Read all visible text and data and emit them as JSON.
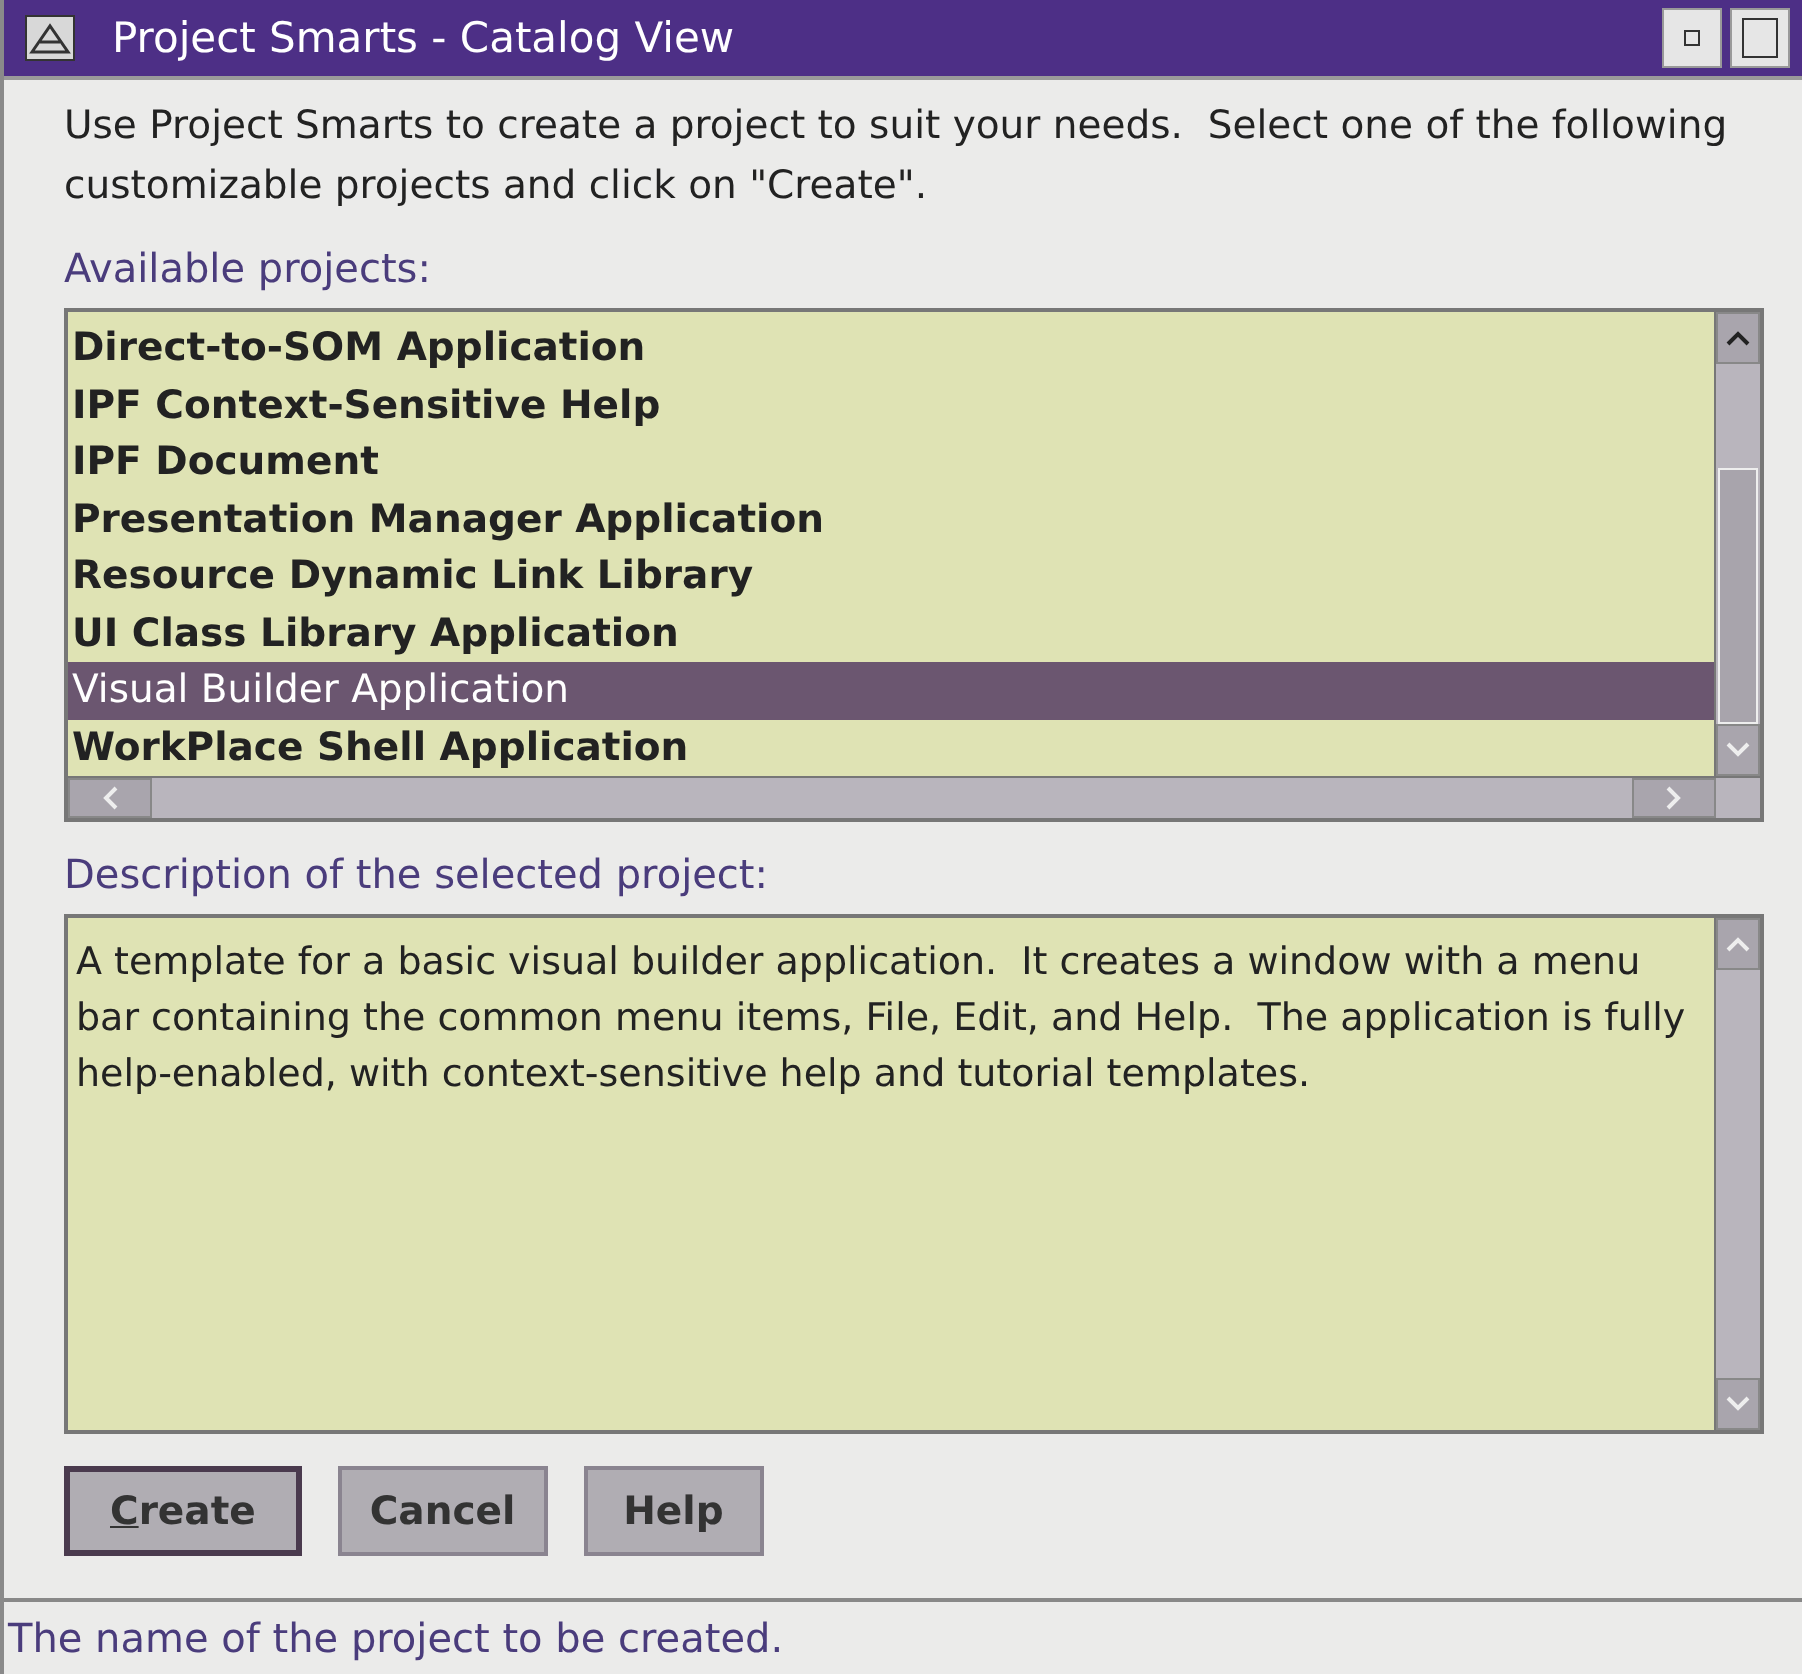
{
  "window": {
    "title": "Project Smarts - Catalog View"
  },
  "intro": "Use Project Smarts to create a project to suit your needs.  Select one of the following customizable projects and click on \"Create\".",
  "projects": {
    "label": "Available projects:",
    "items": [
      {
        "label": "Direct-to-SOM Application",
        "selected": false
      },
      {
        "label": "IPF Context-Sensitive Help",
        "selected": false
      },
      {
        "label": "IPF Document",
        "selected": false
      },
      {
        "label": "Presentation Manager Application",
        "selected": false
      },
      {
        "label": "Resource Dynamic Link Library",
        "selected": false
      },
      {
        "label": "UI Class Library Application",
        "selected": false
      },
      {
        "label": "Visual Builder Application",
        "selected": true
      },
      {
        "label": "WorkPlace Shell Application",
        "selected": false
      }
    ]
  },
  "description": {
    "label": "Description of the selected project:",
    "text": "A template for a basic visual builder application.  It creates a window with a menu bar containing the common menu items, File, Edit, and Help.  The application is fully help-enabled, with context-sensitive help and tutorial templates."
  },
  "buttons": [
    {
      "label": "Create",
      "default": true
    },
    {
      "label": "Cancel",
      "default": false
    },
    {
      "label": "Help",
      "default": false
    }
  ],
  "status_bar": "The name of the project to be created."
}
